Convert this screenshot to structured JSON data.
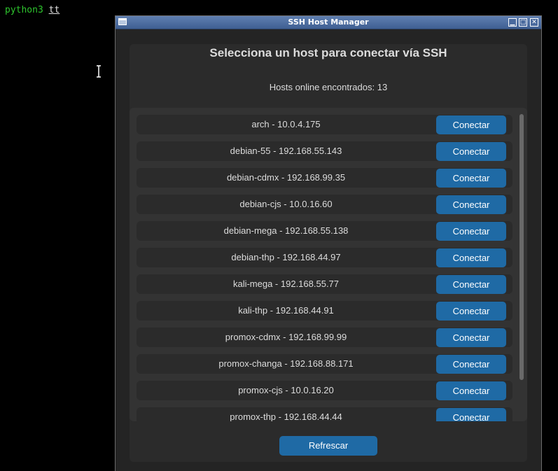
{
  "terminal": {
    "command": "python3",
    "argument": "tt"
  },
  "window": {
    "title": "SSH Host Manager",
    "minimize_glyph": "▁",
    "maximize_glyph": "□",
    "close_glyph": "✕"
  },
  "main": {
    "heading": "Selecciona un host para conectar vía SSH",
    "count_text": "Hosts online encontrados: 13",
    "connect_label": "Conectar",
    "refresh_label": "Refrescar"
  },
  "hosts": [
    {
      "label": "arch - 10.0.4.175",
      "button": "Conectar"
    },
    {
      "label": "debian-55 - 192.168.55.143",
      "button": "Conectar"
    },
    {
      "label": "debian-cdmx - 192.168.99.35",
      "button": "Conectar"
    },
    {
      "label": "debian-cjs - 10.0.16.60",
      "button": "Conectar"
    },
    {
      "label": "debian-mega - 192.168.55.138",
      "button": "Conectar"
    },
    {
      "label": "debian-thp - 192.168.44.97",
      "button": "Conectar"
    },
    {
      "label": "kali-mega - 192.168.55.77",
      "button": "Conectar"
    },
    {
      "label": "kali-thp - 192.168.44.91",
      "button": "Conectar"
    },
    {
      "label": "promox-cdmx - 192.168.99.99",
      "button": "Conectar"
    },
    {
      "label": "promox-changa - 192.168.88.171",
      "button": "Conectar"
    },
    {
      "label": "promox-cjs - 10.0.16.20",
      "button": "Conectar"
    },
    {
      "label": "promox-thp - 192.168.44.44",
      "button": "Conectar"
    }
  ],
  "colors": {
    "accent": "#1f6aa5",
    "terminal_prompt": "#2ec52e"
  }
}
